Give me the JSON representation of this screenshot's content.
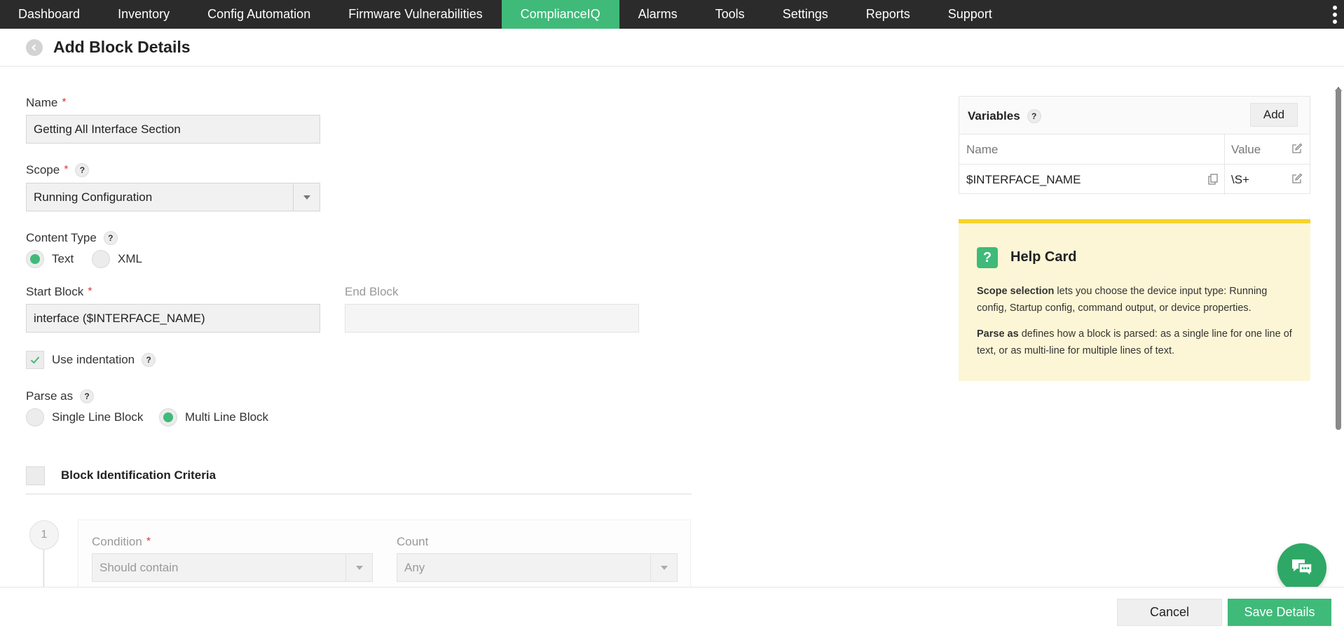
{
  "nav": {
    "items": [
      "Dashboard",
      "Inventory",
      "Config Automation",
      "Firmware Vulnerabilities",
      "ComplianceIQ",
      "Alarms",
      "Tools",
      "Settings",
      "Reports",
      "Support"
    ],
    "active": "ComplianceIQ"
  },
  "header": {
    "title": "Add Block Details"
  },
  "form": {
    "name_label": "Name",
    "name_value": "Getting All Interface Section",
    "scope_label": "Scope",
    "scope_value": "Running Configuration",
    "content_type_label": "Content Type",
    "content_type_options": [
      "Text",
      "XML"
    ],
    "content_type_selected": "Text",
    "start_block_label": "Start Block",
    "start_block_value": "interface ($INTERFACE_NAME)",
    "end_block_label": "End Block",
    "end_block_value": "",
    "use_indentation_label": "Use indentation",
    "use_indentation_checked": true,
    "parse_as_label": "Parse as",
    "parse_as_options": [
      "Single Line Block",
      "Multi Line Block"
    ],
    "parse_as_selected": "Multi Line Block",
    "block_criteria_label": "Block Identification Criteria",
    "block_criteria_checked": false,
    "criteria": {
      "step": "1",
      "condition_label": "Condition",
      "condition_value": "Should contain",
      "count_label": "Count",
      "count_value": "Any"
    }
  },
  "variables": {
    "title": "Variables",
    "add_label": "Add",
    "columns": [
      "Name",
      "Value"
    ],
    "rows": [
      {
        "name": "$INTERFACE_NAME",
        "value": "\\S+"
      }
    ]
  },
  "help_card": {
    "icon": "?",
    "title": "Help Card",
    "p1_bold": "Scope selection",
    "p1_text": " lets you choose the device input type: Running config, Startup config, command output, or device properties.",
    "p2_bold": "Parse as",
    "p2_text": " defines how a block is parsed: as a single line for one line of text, or as multi-line for multiple lines of text."
  },
  "footer": {
    "cancel_label": "Cancel",
    "save_label": "Save Details"
  },
  "colors": {
    "accent": "#3fba79",
    "nav_bg": "#2b2b2b",
    "help_bg": "#fdf6d6",
    "help_border": "#f7d32b",
    "required": "#e0383e"
  },
  "icons": {
    "back": "chevron-left-icon",
    "help": "question-icon",
    "copy": "copy-icon",
    "edit": "edit-icon",
    "chat": "chat-icon",
    "check": "check-icon",
    "dropdown": "caret-down-icon"
  }
}
